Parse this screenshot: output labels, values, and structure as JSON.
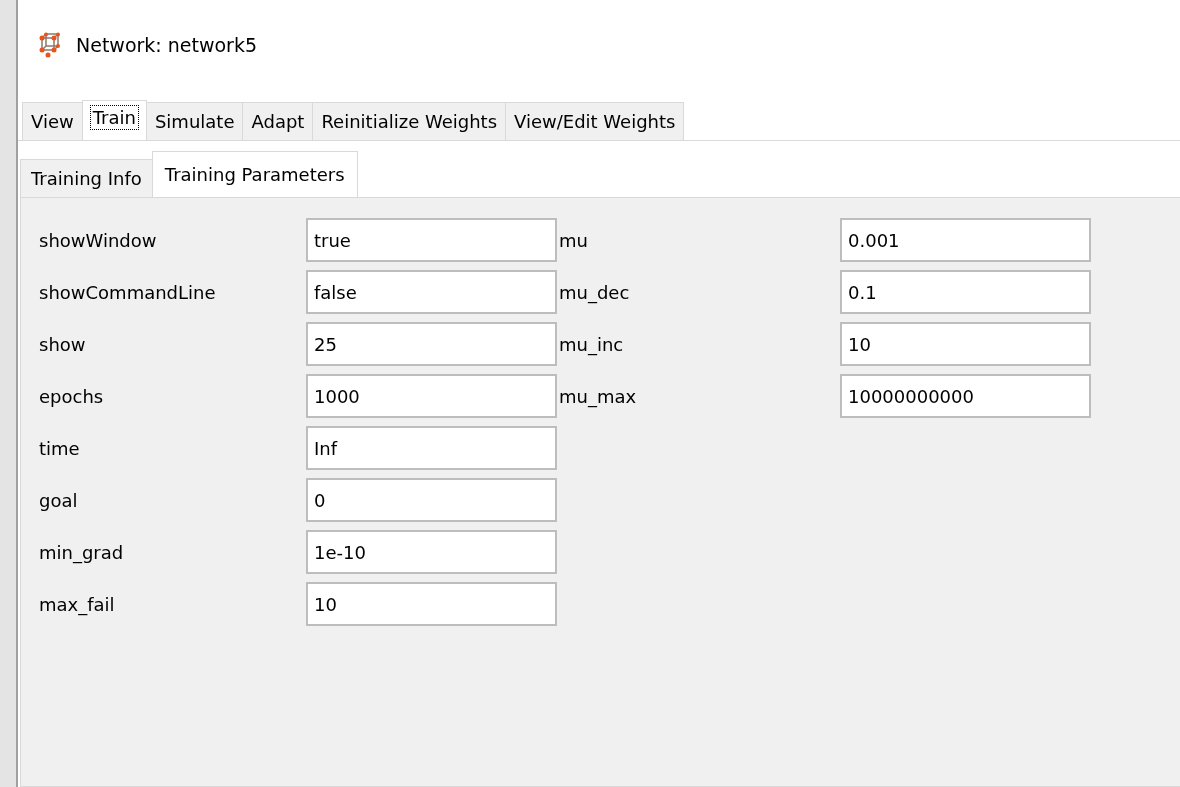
{
  "window": {
    "title": "Network: network5"
  },
  "tabs": [
    {
      "label": "View",
      "selected": false
    },
    {
      "label": "Train",
      "selected": true
    },
    {
      "label": "Simulate",
      "selected": false
    },
    {
      "label": "Adapt",
      "selected": false
    },
    {
      "label": "Reinitialize Weights",
      "selected": false
    },
    {
      "label": "View/Edit Weights",
      "selected": false
    }
  ],
  "subtabs": [
    {
      "label": "Training Info",
      "selected": false
    },
    {
      "label": "Training Parameters",
      "selected": true
    }
  ],
  "parameters": [
    [
      {
        "name": "showWindow",
        "value": "true"
      },
      {
        "name": "showCommandLine",
        "value": "false"
      },
      {
        "name": "show",
        "value": "25"
      },
      {
        "name": "epochs",
        "value": "1000"
      },
      {
        "name": "time",
        "value": "Inf"
      },
      {
        "name": "goal",
        "value": "0"
      },
      {
        "name": "min_grad",
        "value": "1e-10"
      },
      {
        "name": "max_fail",
        "value": "10"
      }
    ],
    [
      {
        "name": "mu",
        "value": "0.001"
      },
      {
        "name": "mu_dec",
        "value": "0.1"
      },
      {
        "name": "mu_inc",
        "value": "10"
      },
      {
        "name": "mu_max",
        "value": "10000000000"
      }
    ]
  ]
}
